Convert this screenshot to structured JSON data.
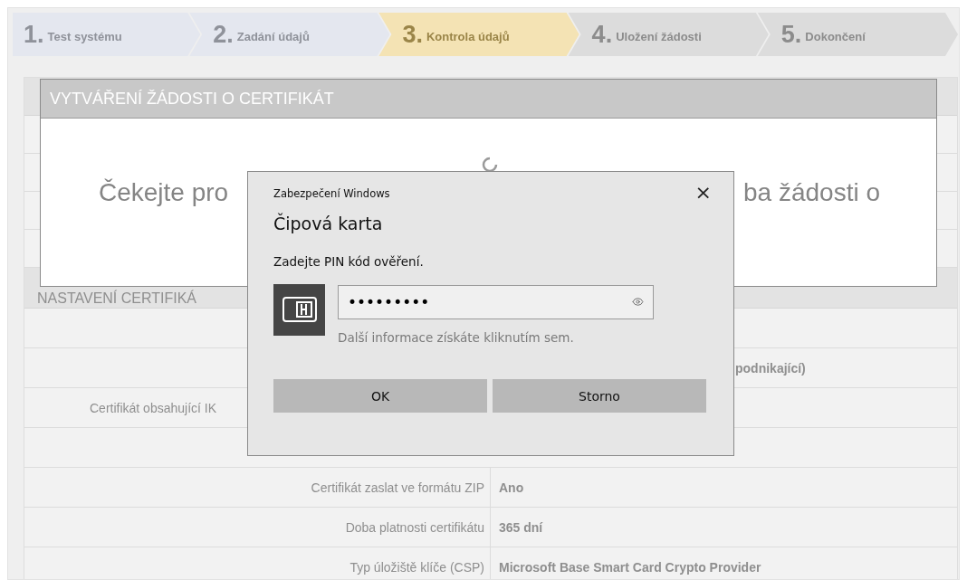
{
  "steps": [
    {
      "number": "1.",
      "label": "Test systému",
      "completed": true,
      "selected": false
    },
    {
      "number": "2.",
      "label": "Zadání údajů",
      "completed": true,
      "selected": false
    },
    {
      "number": "3.",
      "label": "Kontrola údajů",
      "completed": false,
      "selected": true
    },
    {
      "number": "4.",
      "label": "Uložení žádosti",
      "completed": false,
      "selected": false
    },
    {
      "number": "5.",
      "label": "Dokončení",
      "completed": false,
      "selected": false
    }
  ],
  "settings_section": {
    "title": "NASTAVENÍ CERTIFIKÁ",
    "rows": [
      {},
      {
        "value": "podnikající)"
      },
      {
        "label": "Certifikát obsahující IK"
      },
      {},
      {
        "label": "Certifikát zaslat ve formátu ZIP",
        "value": "Ano"
      },
      {
        "label": "Doba platnosti certifikátu",
        "value": "365 dní"
      },
      {
        "label": "Typ úložiště klíče (CSP)",
        "value": "Microsoft Base Smart Card Crypto Provider"
      }
    ]
  },
  "progress_modal": {
    "title": "VYTVÁŘENÍ ŽÁDOSTI O CERTIFIKÁT",
    "message_left": "Čekejte pro",
    "message_right": "ba žádosti o"
  },
  "security_dialog": {
    "window_title": "Zabezpečení Windows",
    "close": "×",
    "heading": "Čipová karta",
    "prompt": "Zadejte PIN kód ověření.",
    "pin_field": {
      "value": "•••••••••"
    },
    "help_link": "Další informace získáte kliknutím sem.",
    "buttons": [
      "OK",
      "Storno"
    ]
  }
}
